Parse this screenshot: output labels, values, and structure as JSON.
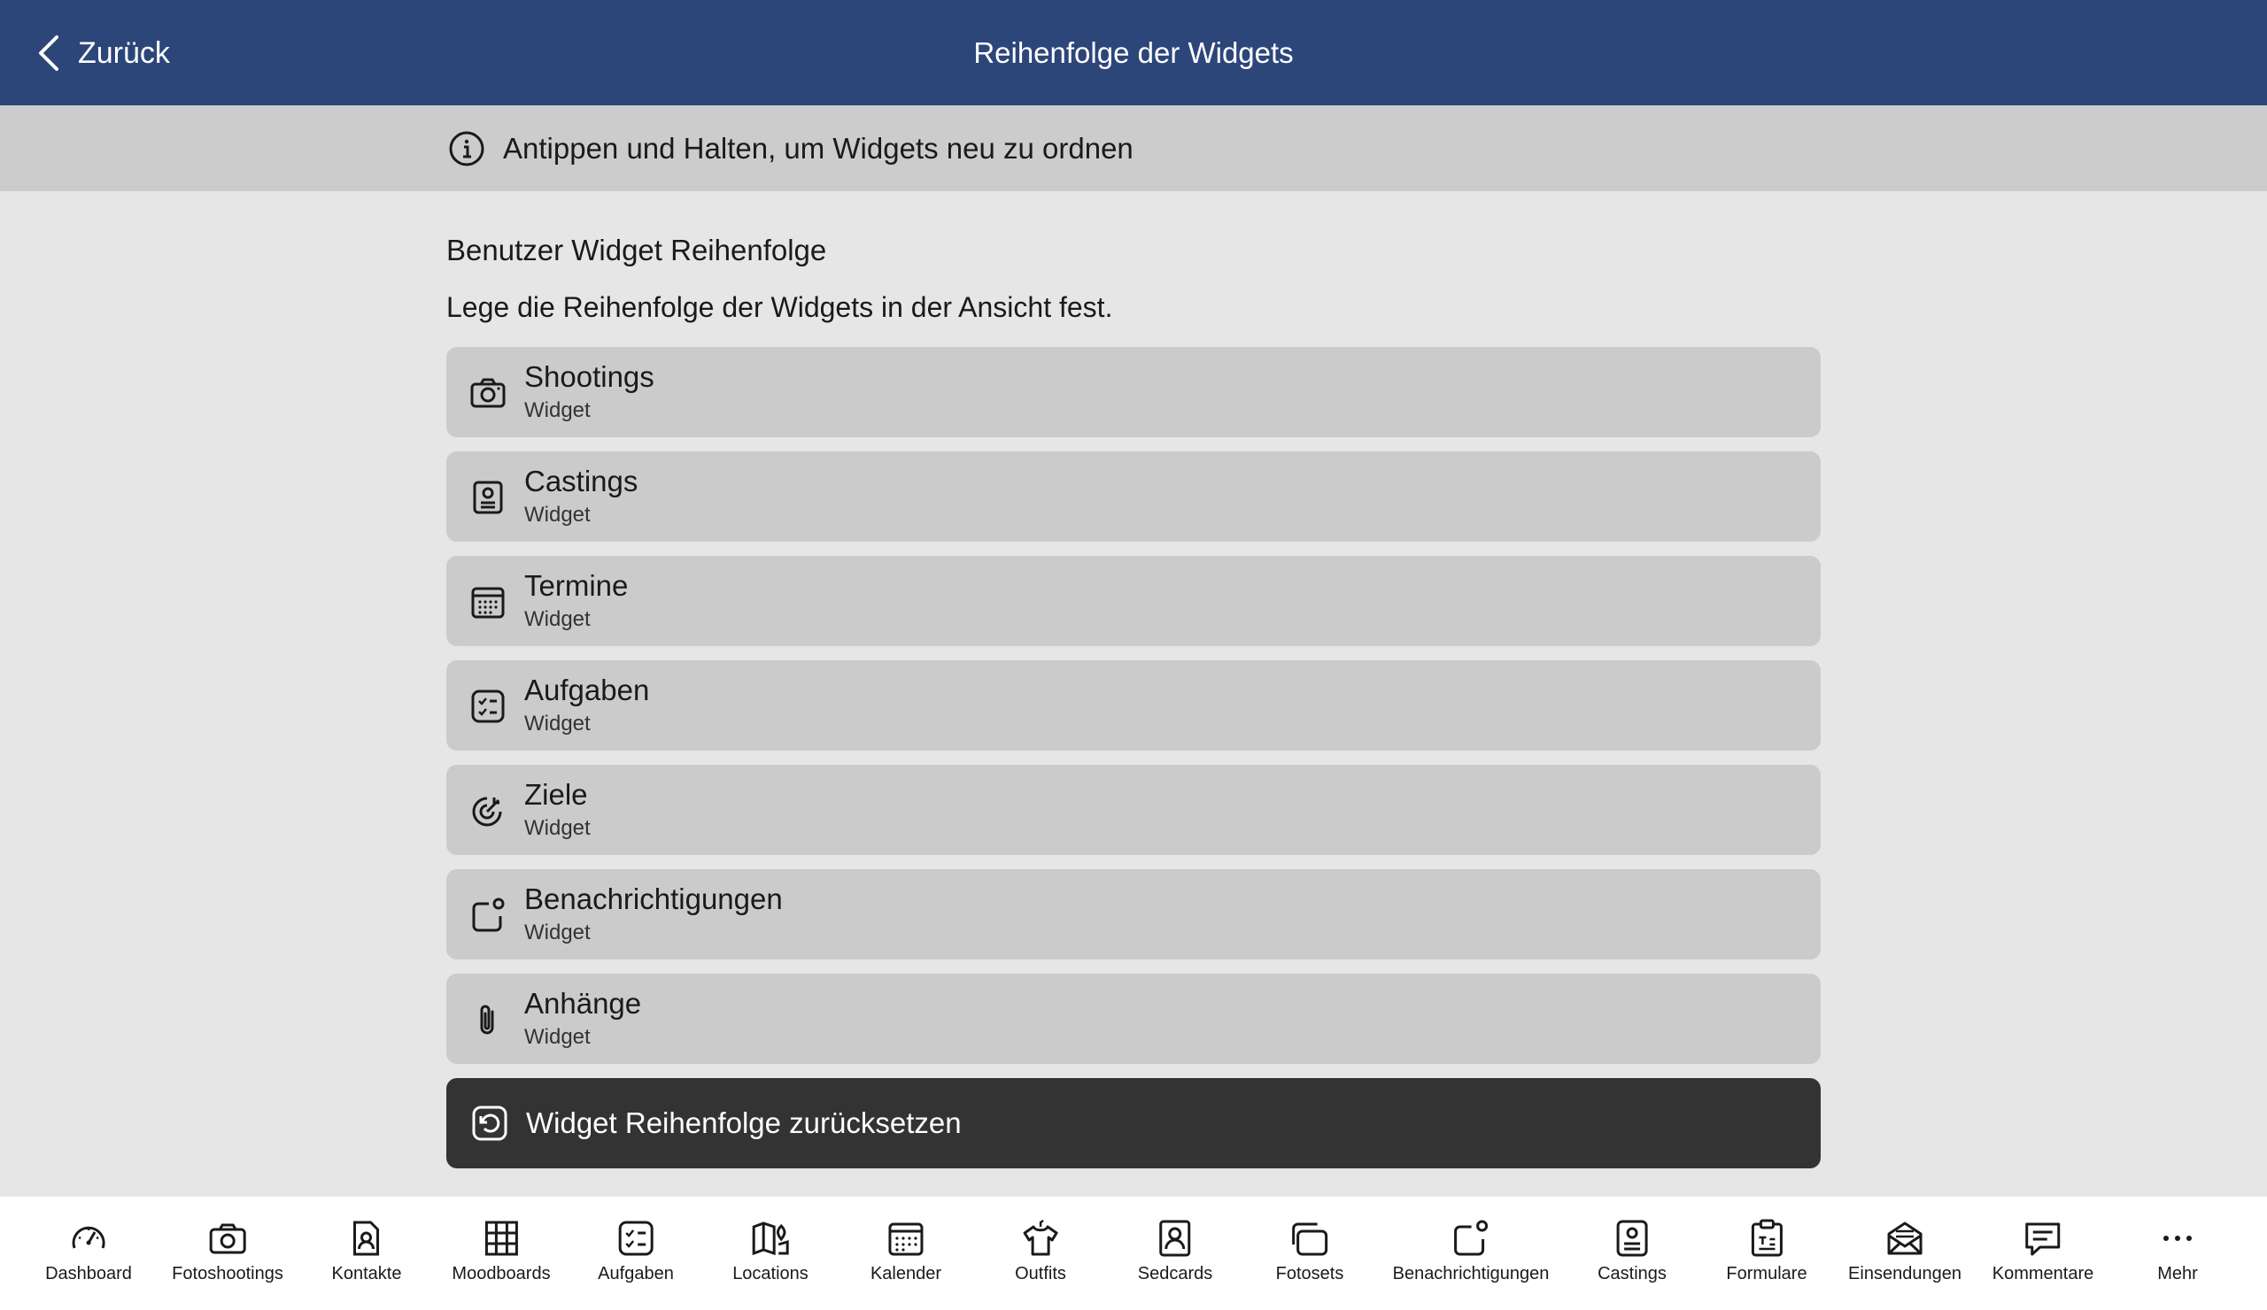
{
  "header": {
    "back_label": "Zurück",
    "title": "Reihenfolge der Widgets"
  },
  "info": {
    "text": "Antippen und Halten, um Widgets neu zu ordnen"
  },
  "section": {
    "title": "Benutzer Widget Reihenfolge",
    "description": "Lege die Reihenfolge der Widgets in der Ansicht fest."
  },
  "widgets": [
    {
      "title": "Shootings",
      "subtitle": "Widget",
      "icon": "camera-icon"
    },
    {
      "title": "Castings",
      "subtitle": "Widget",
      "icon": "id-card-icon"
    },
    {
      "title": "Termine",
      "subtitle": "Widget",
      "icon": "calendar-icon"
    },
    {
      "title": "Aufgaben",
      "subtitle": "Widget",
      "icon": "checklist-icon"
    },
    {
      "title": "Ziele",
      "subtitle": "Widget",
      "icon": "target-icon"
    },
    {
      "title": "Benachrichtigungen",
      "subtitle": "Widget",
      "icon": "notification-icon"
    },
    {
      "title": "Anhänge",
      "subtitle": "Widget",
      "icon": "paperclip-icon"
    }
  ],
  "reset_button": {
    "label": "Widget Reihenfolge zurücksetzen",
    "icon": "reset-icon"
  },
  "tabs": [
    {
      "label": "Dashboard",
      "icon": "gauge-icon"
    },
    {
      "label": "Fotoshootings",
      "icon": "camera-icon"
    },
    {
      "label": "Kontakte",
      "icon": "contact-icon"
    },
    {
      "label": "Moodboards",
      "icon": "grid-icon"
    },
    {
      "label": "Aufgaben",
      "icon": "checklist-icon"
    },
    {
      "label": "Locations",
      "icon": "map-pin-icon"
    },
    {
      "label": "Kalender",
      "icon": "calendar-icon"
    },
    {
      "label": "Outfits",
      "icon": "shirt-icon"
    },
    {
      "label": "Sedcards",
      "icon": "id-card-icon"
    },
    {
      "label": "Fotosets",
      "icon": "photo-stack-icon"
    },
    {
      "label": "Benachrichtigungen",
      "icon": "notification-icon"
    },
    {
      "label": "Castings",
      "icon": "id-card-icon"
    },
    {
      "label": "Formulare",
      "icon": "clipboard-icon"
    },
    {
      "label": "Einsendungen",
      "icon": "envelope-icon"
    },
    {
      "label": "Kommentare",
      "icon": "comment-icon"
    },
    {
      "label": "Mehr",
      "icon": "more-icon"
    }
  ],
  "colors": {
    "header_bg": "#2c4679",
    "info_bg": "#cccccc",
    "row_bg": "#cbcbcb",
    "reset_bg": "#333333"
  }
}
